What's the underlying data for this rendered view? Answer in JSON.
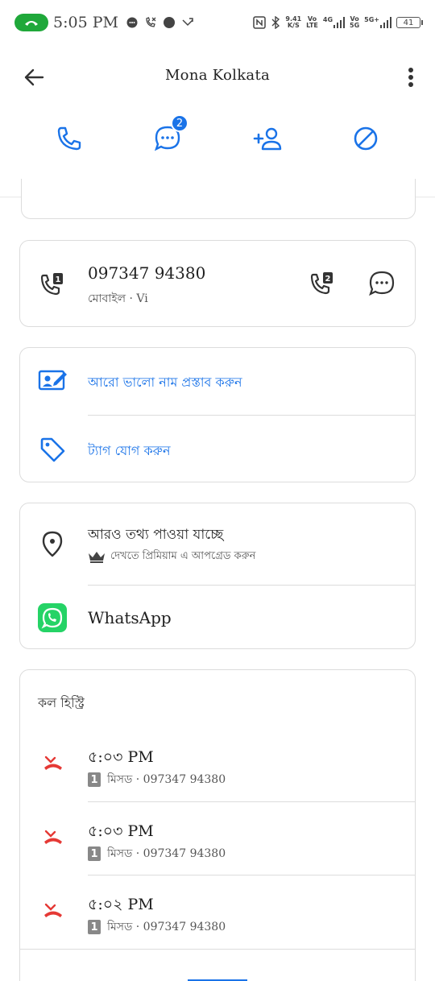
{
  "status_bar": {
    "time": "5:05 PM",
    "net_speed": "9.41",
    "net_unit": "K/S",
    "sim1_label_top": "Vo",
    "sim1_label_bottom": "LTE",
    "sim1_gen": "4G",
    "sim2_label_top": "Vo",
    "sim2_label_bottom": "5G",
    "sim2_gen": "5G+",
    "battery": "41"
  },
  "app_bar": {
    "title": "Mona Kolkata"
  },
  "actions": {
    "message_badge": "2"
  },
  "phone_card": {
    "number": "097347 94380",
    "subtitle": "মোবাইল · Vi"
  },
  "links_card": {
    "suggest_name": "আরো ভালো নাম প্রস্তাব করুন",
    "add_tag": "ট্যাগ যোগ করুন"
  },
  "info_card": {
    "title": "আরও তথ্য পাওয়া যাচ্ছে",
    "subtitle": "দেখতে প্রিমিয়াম এ আপগ্রেড করুন",
    "whatsapp": "WhatsApp"
  },
  "history": {
    "title": "কল হিস্ট্রি",
    "calls": [
      {
        "time": "৫:০৩ PM",
        "sim": "1",
        "detail": "মিসড · 097347 94380"
      },
      {
        "time": "৫:০৩ PM",
        "sim": "1",
        "detail": "মিসড · 097347 94380"
      },
      {
        "time": "৫:০২ PM",
        "sim": "1",
        "detail": "মিসড · 097347 94380"
      }
    ]
  },
  "colors": {
    "accent": "#1a73e8",
    "missed": "#e53935",
    "whatsapp": "#25d366",
    "call_pill": "#1fa83a"
  }
}
